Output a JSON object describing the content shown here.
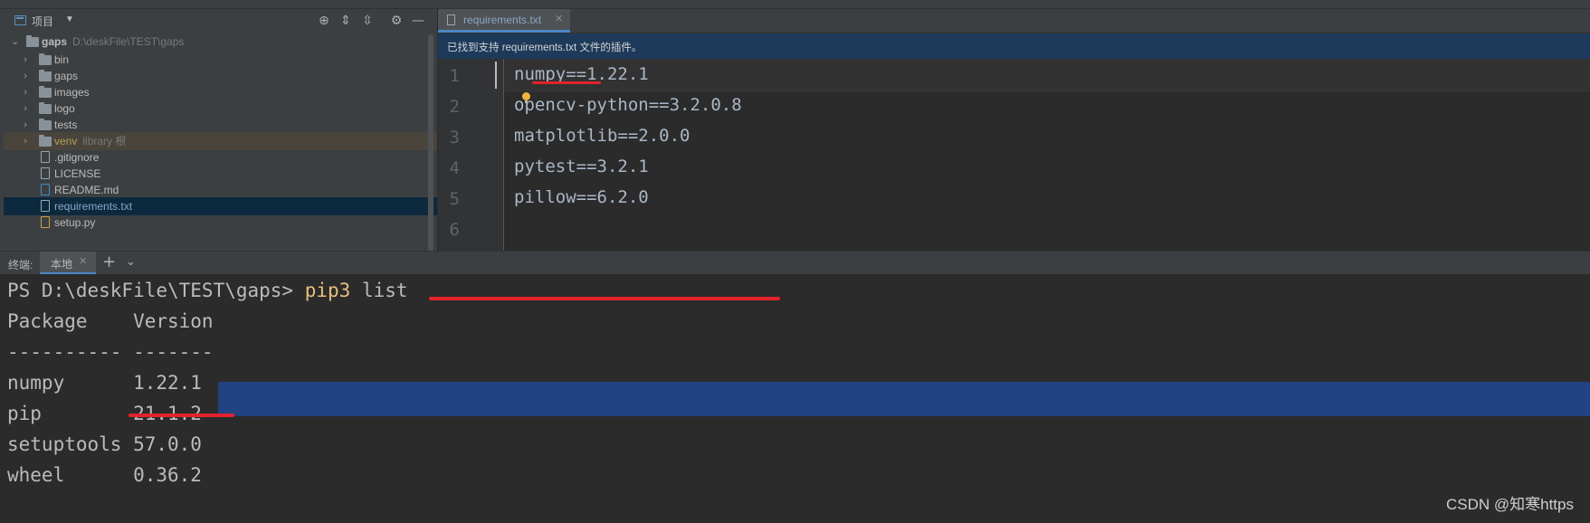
{
  "project_panel": {
    "title": "项目",
    "tree": [
      {
        "name": "gaps",
        "hint": "D:\\deskFile\\TEST\\gaps",
        "type": "folder",
        "expanded": true,
        "root": true
      },
      {
        "name": "bin",
        "type": "folder"
      },
      {
        "name": "gaps",
        "type": "folder"
      },
      {
        "name": "images",
        "type": "folder"
      },
      {
        "name": "logo",
        "type": "folder"
      },
      {
        "name": "tests",
        "type": "folder"
      },
      {
        "name": "venv",
        "hint": "library 根",
        "type": "folder"
      },
      {
        "name": ".gitignore",
        "type": "file"
      },
      {
        "name": "LICENSE",
        "type": "file"
      },
      {
        "name": "README.md",
        "type": "file-md"
      },
      {
        "name": "requirements.txt",
        "type": "file",
        "selected": true
      },
      {
        "name": "setup.py",
        "type": "file-py"
      }
    ]
  },
  "editor": {
    "tab_label": "requirements.txt",
    "banner": "已找到支持 requirements.txt 文件的插件。",
    "lines": [
      {
        "num": "1",
        "text": "numpy==1.22.1"
      },
      {
        "num": "2",
        "text": "opencv-python==3.2.0.8"
      },
      {
        "num": "3",
        "text": "matplotlib==2.0.0"
      },
      {
        "num": "4",
        "text": "pytest==3.2.1"
      },
      {
        "num": "5",
        "text": "pillow==6.2.0"
      },
      {
        "num": "6",
        "text": ""
      }
    ]
  },
  "terminal": {
    "title": "终端:",
    "tab_label": "本地",
    "prompt": "PS D:\\deskFile\\TEST\\gaps> ",
    "command": "pip3",
    "command_args": " list",
    "header": "Package    Version",
    "separator": "---------- -------",
    "packages": [
      {
        "name": "numpy",
        "version": "1.22.1",
        "row": "numpy      1.22.1"
      },
      {
        "name": "pip",
        "version": "21.1.2",
        "row": "pip        21.1.2"
      },
      {
        "name": "setuptools",
        "version": "57.0.0",
        "row": "setuptools 57.0.0"
      },
      {
        "name": "wheel",
        "version": "0.36.2",
        "row": "wheel      0.36.2"
      }
    ]
  },
  "watermark": "CSDN @知寒https",
  "colors": {
    "accent": "#4a88c7",
    "selection": "#214283",
    "annotation": "#e3232b"
  }
}
